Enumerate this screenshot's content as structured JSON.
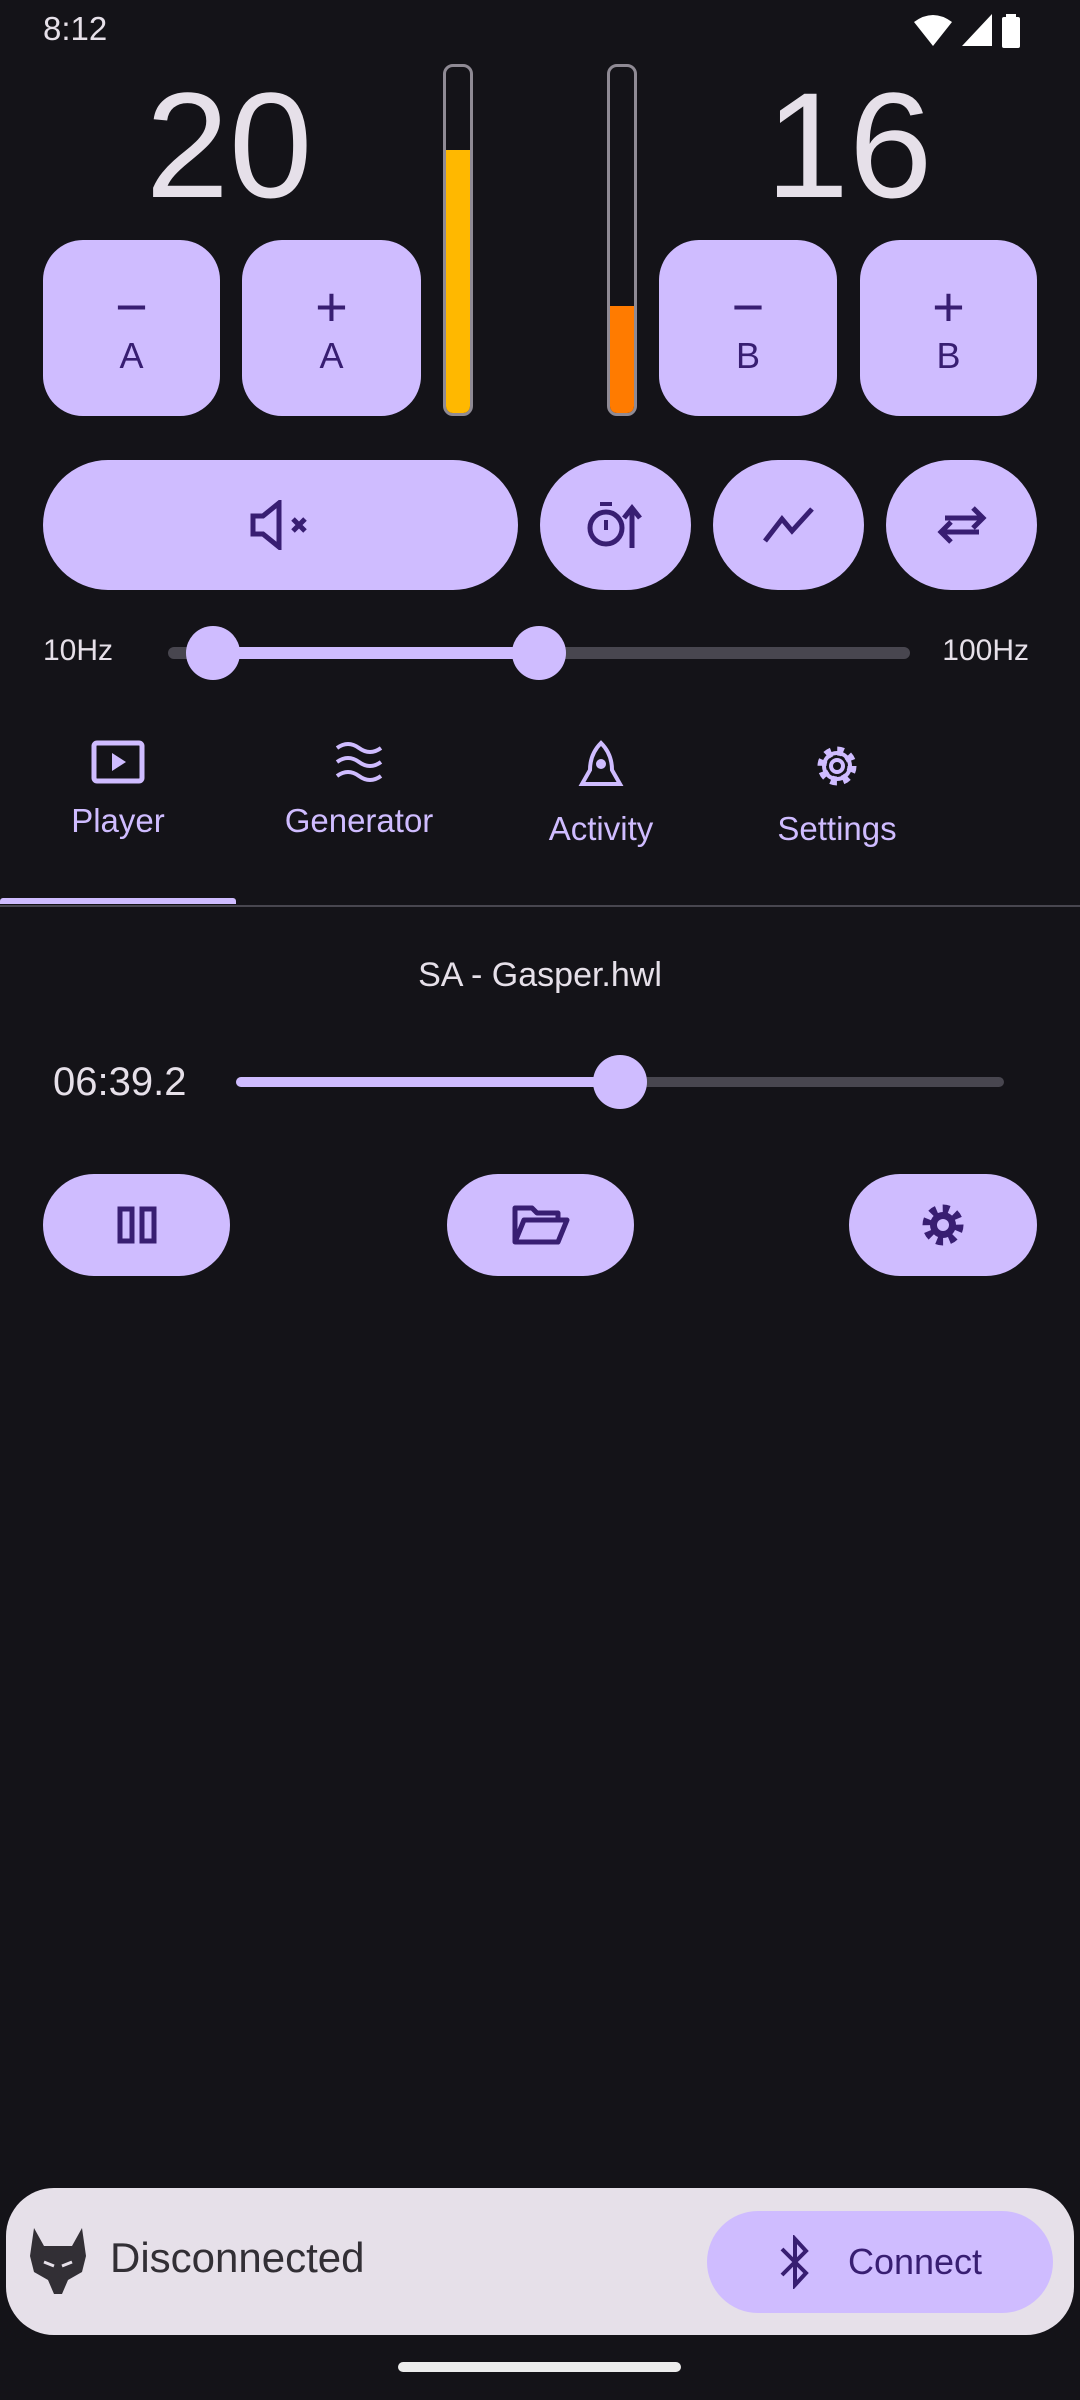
{
  "status_bar": {
    "time": "8:12"
  },
  "channel_a": {
    "value": "20",
    "level": 0.76,
    "level_color": "#ffb800",
    "minus_label": "A",
    "plus_label": "A"
  },
  "channel_b": {
    "value": "16",
    "level": 0.31,
    "level_color": "#ff7b00",
    "minus_label": "B",
    "plus_label": "B"
  },
  "frequency": {
    "min_label": "10Hz",
    "max_label": "100Hz",
    "low_fraction": 0.06,
    "high_fraction": 0.5
  },
  "tabs": [
    {
      "label": "Player",
      "icon": "play-icon",
      "selected": true
    },
    {
      "label": "Generator",
      "icon": "waves-icon"
    },
    {
      "label": "Activity",
      "icon": "rocket-icon"
    },
    {
      "label": "Settings",
      "icon": "gear-icon"
    }
  ],
  "player": {
    "file": "SA - Gasper.hwl",
    "time": "06:39.2",
    "progress": 0.5
  },
  "connection": {
    "status": "Disconnected",
    "button_label": "Connect"
  },
  "colors": {
    "accent": "#cfbcff",
    "on_accent": "#381e72",
    "background": "#141318"
  }
}
